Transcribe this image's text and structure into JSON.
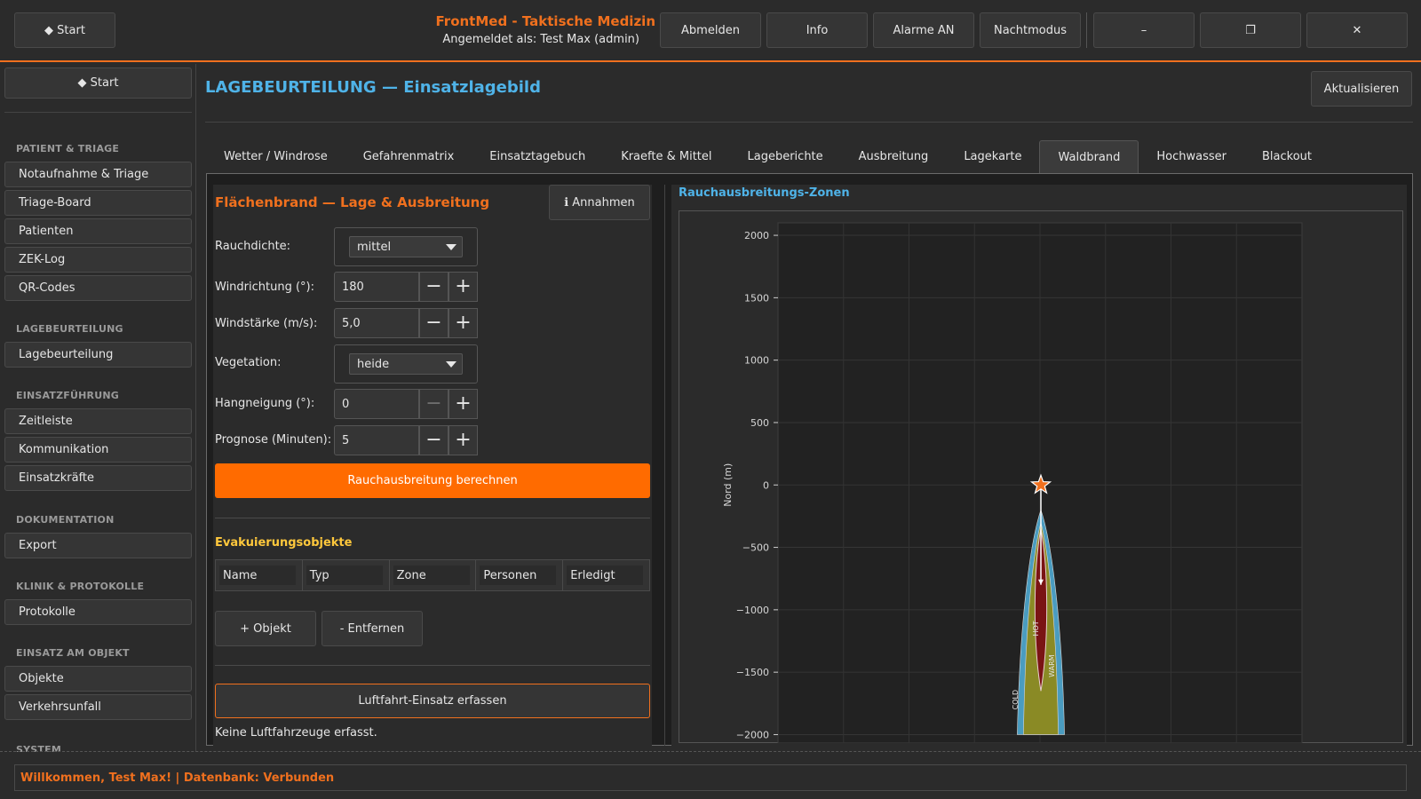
{
  "topbar": {
    "start_label": "◆  Start",
    "app_title": "FrontMed - Taktische Medizin",
    "login_info": "Angemeldet als: Test Max (admin)",
    "buttons": [
      "Abmelden",
      "Info",
      "Alarme AN",
      "Nachtmodus"
    ],
    "minimize": "–",
    "maximize": "❐",
    "close": "✕"
  },
  "sidebar": {
    "start_label": "◆  Start",
    "sections": [
      {
        "title": "PATIENT & TRIAGE",
        "items": [
          "Notaufnahme & Triage",
          "Triage-Board",
          "Patienten",
          "ZEK-Log",
          "QR-Codes"
        ]
      },
      {
        "title": "LAGEBEURTEILUNG",
        "items": [
          "Lagebeurteilung"
        ]
      },
      {
        "title": "EINSATZFÜHRUNG",
        "items": [
          "Zeitleiste",
          "Kommunikation",
          "Einsatzkräfte"
        ]
      },
      {
        "title": "DOKUMENTATION",
        "items": [
          "Export"
        ]
      },
      {
        "title": "KLINIK & PROTOKOLLE",
        "items": [
          "Protokolle"
        ]
      },
      {
        "title": "EINSATZ AM OBJEKT",
        "items": [
          "Objekte",
          "Verkehrsunfall"
        ]
      },
      {
        "title": "SYSTEM",
        "items": []
      }
    ]
  },
  "main": {
    "title": "LAGEBEURTEILUNG — Einsatzlagebild",
    "refresh_label": "Aktualisieren",
    "tabs": [
      "Wetter / Windrose",
      "Gefahrenmatrix",
      "Einsatztagebuch",
      "Kraefte & Mittel",
      "Lageberichte",
      "Ausbreitung",
      "Lagekarte",
      "Waldbrand",
      "Hochwasser",
      "Blackout"
    ],
    "active_tab": "Waldbrand"
  },
  "form": {
    "title": "Flächenbrand — Lage & Ausbreitung",
    "annahmen_label": "ℹ Annahmen",
    "rauchdichte_label": "Rauchdichte:",
    "rauchdichte_value": "mittel",
    "windrichtung_label": "Windrichtung (°):",
    "windrichtung_value": "180",
    "windstaerke_label": "Windstärke (m/s):",
    "windstaerke_value": "5,0",
    "vegetation_label": "Vegetation:",
    "vegetation_value": "heide",
    "hangneigung_label": "Hangneigung (°):",
    "hangneigung_value": "0",
    "prognose_label": "Prognose (Minuten):",
    "prognose_value": "5",
    "minus": "−",
    "plus": "+",
    "calc_label": "Rauchausbreitung berechnen",
    "evac_title": "Evakuierungsobjekte",
    "evac_columns": [
      "Name",
      "Typ",
      "Zone",
      "Personen",
      "Erledigt"
    ],
    "add_label": "+ Objekt",
    "remove_label": "- Entfernen",
    "air_label": "Luftfahrt-Einsatz erfassen",
    "air_status": "Keine Luftfahrzeuge erfasst."
  },
  "chart": {
    "title": "Rauchausbreitungs-Zonen"
  },
  "chart_data": {
    "type": "area",
    "ylabel": "Nord (m)",
    "xlabel": "",
    "ylim": [
      -2050,
      2100
    ],
    "yticks": [
      2000,
      1500,
      1000,
      500,
      0,
      -500,
      -1000,
      -1500,
      -2000
    ],
    "ytick_labels": [
      "2000",
      "1500",
      "1000",
      "500",
      "0",
      "−500",
      "−1000",
      "−1500",
      "−2000"
    ],
    "grid": true,
    "source": {
      "x": 0,
      "y": 0,
      "marker": "star"
    },
    "wind_direction_deg": 180,
    "zones": [
      {
        "name": "COLD",
        "color": "#4a9cc0",
        "half_width_m": 38,
        "start_y": -200,
        "end_y": -2000
      },
      {
        "name": "WARM",
        "color": "#8a8a25",
        "half_width_m": 28,
        "start_y": -300,
        "end_y": -2000
      },
      {
        "name": "HOT",
        "color": "#7a1414",
        "half_width_m": 14,
        "start_y": -350,
        "end_y": -1650
      }
    ]
  },
  "status": {
    "text": "Willkommen, Test Max! | Datenbank: Verbunden"
  }
}
